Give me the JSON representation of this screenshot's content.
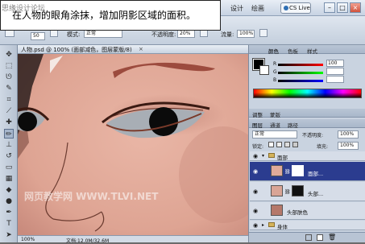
{
  "caption": "在人物的眼角涂抹，增加阴影区域的面积。",
  "watermark_top": "思缘设计论坛",
  "watermark_bottom": "网页教学网 WWW.TLVI.NET",
  "menubar": {
    "items": [
      "设计",
      "绘画"
    ],
    "cslive": "CS Live",
    "min": "–",
    "max": "□",
    "close": "×"
  },
  "options": {
    "size": "50",
    "mode_label": "模式:",
    "mode_value": "正常",
    "opacity_label": "不透明度:",
    "opacity_value": "20%",
    "flow_label": "流量:",
    "flow_value": "100%"
  },
  "document": {
    "title": "人物.psd @ 100% (面部减色，图层蒙版/8)",
    "close": "×",
    "zoom": "100%",
    "doc_size": "文档:12.0M/32.6M"
  },
  "color_panel": {
    "tabs": [
      "颜色",
      "色板",
      "样式"
    ],
    "r_label": "R",
    "g_label": "G",
    "b_label": "B",
    "r_value": "100",
    "g_value": "",
    "b_value": ""
  },
  "layers_panel": {
    "tabs": [
      "图层",
      "通道",
      "路径"
    ],
    "adjust_tabs": [
      "调整",
      "蒙版"
    ],
    "blend_mode": "正常",
    "opacity_label": "不透明度:",
    "opacity_value": "100%",
    "lock_label": "锁定:",
    "fill_label": "填充:",
    "fill_value": "100%",
    "groups": [
      {
        "name": "面部"
      },
      {
        "name": "身体"
      }
    ],
    "layers": [
      {
        "name": "面部...",
        "selected": true
      },
      {
        "name": "头部...",
        "selected": false
      },
      {
        "name": "头部肤色",
        "selected": false
      }
    ]
  },
  "colors": {
    "skin": "#e0aa9a",
    "selection": "#2b3c8f",
    "brow": "#9c4b3e"
  }
}
